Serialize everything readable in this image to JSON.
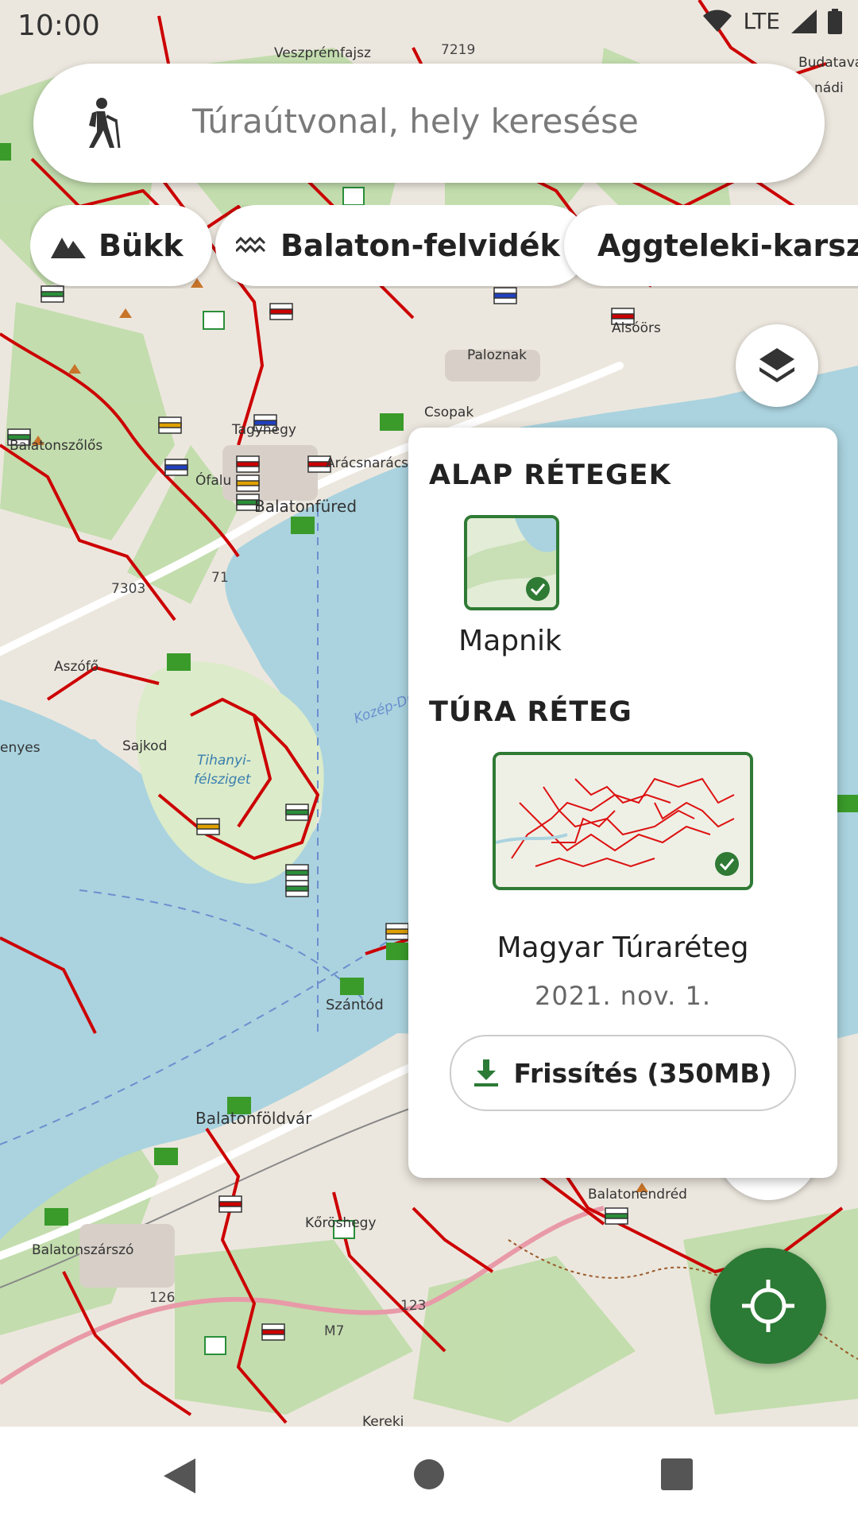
{
  "status": {
    "time": "10:00",
    "network": "LTE"
  },
  "search": {
    "placeholder": "Túraútvonal, hely keresése",
    "icon": "hiker-icon"
  },
  "chips": [
    {
      "label": "Bükk",
      "icon": "mountain-icon"
    },
    {
      "label": "Balaton-felvidék",
      "icon": "waves-icon"
    },
    {
      "label": "Aggteleki-karszt",
      "icon": "cave-icon"
    }
  ],
  "map": {
    "labels": [
      "Veszprémfajsz",
      "7219",
      "Budatava",
      "nádi",
      "Paloznak",
      "Alsóörs",
      "Csopak",
      "Tagyhegy",
      "Balatonszőlős",
      "Arácsnarács",
      "Ófalu",
      "Balatonfüred",
      "7303",
      "71",
      "Aszófő",
      "Tihanyi-félsziget",
      "Sajkod",
      "Kozép-Dunántúl",
      "Szántód",
      "Balatonföldvár",
      "Balatonendréd",
      "Kőröshegy",
      "Balatonszárszó",
      "126",
      "M7",
      "123",
      "Kereki",
      "enyes"
    ],
    "water_color": "#aad3df",
    "route_color": "#cc0000",
    "land_color": "#e8e3d8",
    "forest_color": "#b7d99c"
  },
  "layers_panel": {
    "base_title": "ALAP RÉTEGEK",
    "base_layer_name": "Mapnik",
    "hiking_title": "TÚRA RÉTEG",
    "hiking_layer_name": "Magyar Túraréteg",
    "hiking_layer_date": "2021. nov. 1.",
    "refresh_label": "Frissítés (350MB)"
  },
  "colors": {
    "accent": "#2b7a35"
  }
}
